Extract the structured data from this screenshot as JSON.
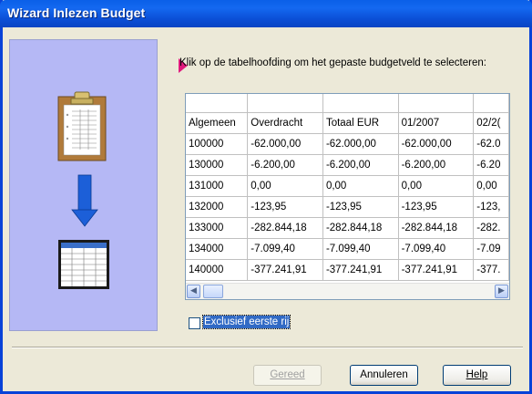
{
  "window": {
    "title": "Wizard Inlezen Budget"
  },
  "instruction": "Klik op de tabelhoofding om het gepaste budgetveld te selecteren:",
  "grid": {
    "headers": [
      "Algemeen",
      "Overdracht",
      "Totaal EUR",
      "01/2007",
      "02/2("
    ],
    "rows": [
      [
        "100000",
        "-62.000,00",
        "-62.000,00",
        "-62.000,00",
        "-62.0"
      ],
      [
        "130000",
        "-6.200,00",
        "-6.200,00",
        "-6.200,00",
        "-6.20"
      ],
      [
        "131000",
        "0,00",
        "0,00",
        "0,00",
        "0,00"
      ],
      [
        "132000",
        "-123,95",
        "-123,95",
        "-123,95",
        "-123,"
      ],
      [
        "133000",
        "-282.844,18",
        "-282.844,18",
        "-282.844,18",
        "-282."
      ],
      [
        "134000",
        "-7.099,40",
        "-7.099,40",
        "-7.099,40",
        "-7.09"
      ],
      [
        "140000",
        "-377.241,91",
        "-377.241,91",
        "-377.241,91",
        "-377."
      ]
    ]
  },
  "checkbox": {
    "label": "Exclusief eerste rij",
    "checked": false
  },
  "buttons": {
    "finish": {
      "label": "Gereed",
      "enabled": false
    },
    "cancel": {
      "label": "Annuleren"
    },
    "help": {
      "label": "Help"
    }
  },
  "icons": [
    "clipboard-icon",
    "down-arrow-icon",
    "spreadsheet-icon",
    "pointer-arrow-icon",
    "scroll-left-icon",
    "scroll-right-icon"
  ],
  "colors": {
    "titlebar": "#0a5fe8",
    "leftpanel": "#b5b8f5",
    "pointer": "#e0197d",
    "selection": "#316ac5"
  }
}
